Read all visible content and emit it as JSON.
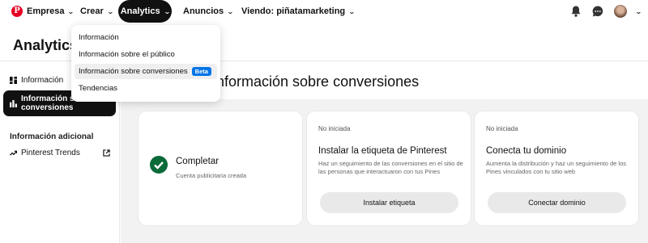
{
  "nav": {
    "logo": "P",
    "business": "Empresa",
    "create": "Crear",
    "analytics": "Analytics",
    "ads": "Anuncios",
    "viewing": "Viendo: piñatamarketing"
  },
  "page": {
    "title": "Analytics"
  },
  "sidebar": {
    "items": [
      {
        "label": "Información"
      },
      {
        "label": "Información sobre conversiones"
      }
    ],
    "extra_heading": "Información adicional",
    "extra_items": [
      {
        "label": "Pinterest Trends"
      }
    ]
  },
  "main": {
    "title": "Información sobre conversiones",
    "cards": [
      {
        "title": "Completar",
        "subtitle": "Cuenta publicitaria creada"
      },
      {
        "status": "No iniciada",
        "title": "Instalar la etiqueta de Pinterest",
        "description": "Haz un seguimiento de las conversiones en el sitio de las personas que interactuaron con tus Pines",
        "button": "Instalar etiqueta"
      },
      {
        "status": "No iniciada",
        "title": "Conecta tu dominio",
        "description": "Aumenta la distribución y haz un seguimiento de los Pines vinculados con tu sitio web",
        "button": "Conectar dominio"
      }
    ]
  },
  "dropdown": {
    "items": [
      {
        "label": "Información"
      },
      {
        "label": "Información sobre el público"
      },
      {
        "label": "Información sobre conversiones",
        "badge": "Beta"
      },
      {
        "label": "Tendencias"
      }
    ]
  },
  "colors": {
    "brand": "#e60023",
    "check": "#0a6a3a",
    "beta": "#0074e8"
  }
}
